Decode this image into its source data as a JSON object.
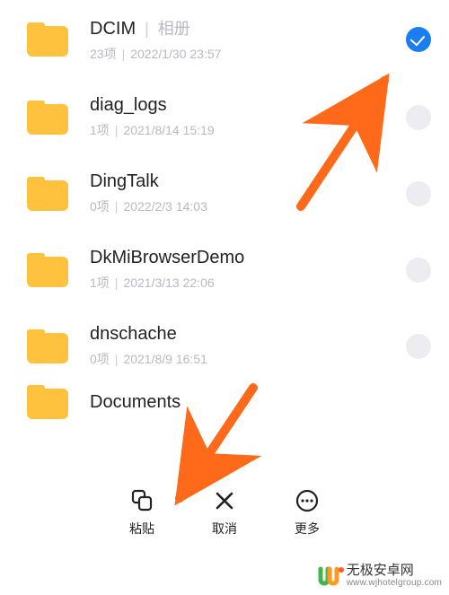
{
  "items": [
    {
      "name": "DCIM",
      "badge": "相册",
      "count": "23项",
      "date": "2022/1/30 23:57",
      "selected": true
    },
    {
      "name": "diag_logs",
      "badge": "",
      "count": "1项",
      "date": "2021/8/14 15:19",
      "selected": false
    },
    {
      "name": "DingTalk",
      "badge": "",
      "count": "0项",
      "date": "2022/2/3 14:03",
      "selected": false
    },
    {
      "name": "DkMiBrowserDemo",
      "badge": "",
      "count": "1项",
      "date": "2021/3/13 22:06",
      "selected": false
    },
    {
      "name": "dnschache",
      "badge": "",
      "count": "0项",
      "date": "2021/8/9 16:51",
      "selected": false
    },
    {
      "name": "Documents",
      "badge": "",
      "count": "",
      "date": "",
      "selected": false
    }
  ],
  "bottom": {
    "paste": "粘贴",
    "cancel": "取消",
    "more": "更多"
  },
  "watermark": {
    "name": "无极安卓网",
    "url": "www.wjhotelgroup.com"
  }
}
